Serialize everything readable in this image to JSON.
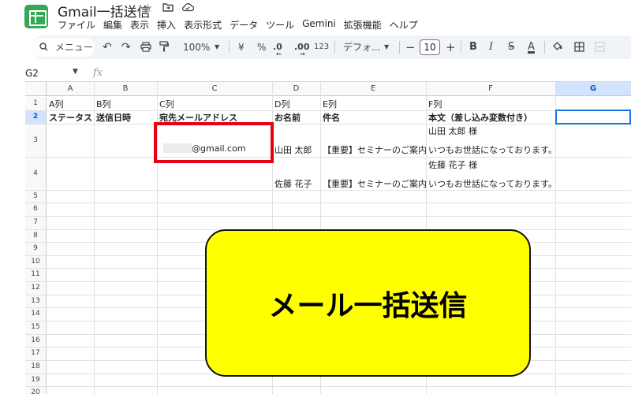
{
  "app": {
    "title": "Gmail一括送信",
    "brand_color": "#34a853"
  },
  "title_icons": [
    "star-icon",
    "folder-move-icon",
    "cloud-status-icon"
  ],
  "menu": [
    "ファイル",
    "編集",
    "表示",
    "挿入",
    "表示形式",
    "データ",
    "ツール",
    "Gemini",
    "拡張機能",
    "ヘルプ"
  ],
  "toolbar": {
    "search_placeholder": "メニュー",
    "zoom": "100%",
    "currency": "¥",
    "percent": "%",
    "decrease_decimal": ".0",
    "increase_decimal": ".00",
    "number_format": "123",
    "font": "デフォ...",
    "font_size": "10",
    "minus": "−",
    "plus": "+",
    "bold": "B",
    "italic": "I",
    "strike": "S",
    "text_color": "A"
  },
  "namebox": "G2",
  "fx_label": "fx",
  "sheet": {
    "columns": [
      "A",
      "B",
      "C",
      "D",
      "E",
      "F",
      "G"
    ],
    "selected_column": "G",
    "selected_row": "2",
    "rows": [
      "1",
      "2",
      "3",
      "4",
      "5",
      "6",
      "7",
      "8",
      "9",
      "10",
      "11",
      "12",
      "13",
      "14",
      "15",
      "16",
      "17",
      "18",
      "19",
      "20"
    ],
    "row1": [
      "A列",
      "B列",
      "C列",
      "D列",
      "E列",
      "F列"
    ],
    "row2": [
      "ステータス",
      "送信日時",
      "宛先メールアドレス",
      "お名前",
      "件名",
      "本文（差し込み変数付き）"
    ],
    "row3": {
      "email": "@gmail.com",
      "name": "山田 太郎",
      "subject": "【重要】セミナーのご案内",
      "body_line1": "山田 太郎 様",
      "body_line2": "いつもお世話になっております。"
    },
    "row4": {
      "name": "佐藤 花子",
      "subject": "【重要】セミナーのご案内",
      "body_line1": "佐藤 花子 様",
      "body_line2": "いつもお世話になっております。"
    }
  },
  "callout": {
    "text": "メール一括送信",
    "color": "#ffff00"
  },
  "highlight_color": "#e60012"
}
